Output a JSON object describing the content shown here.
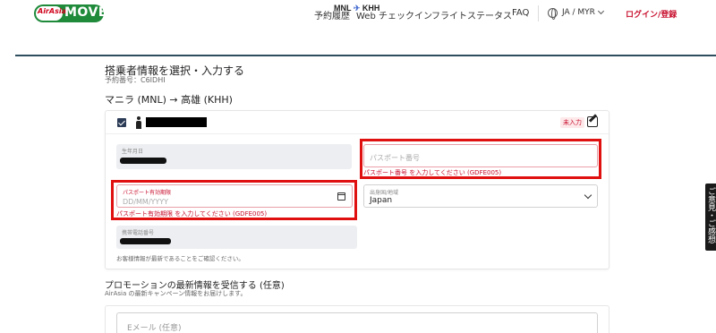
{
  "header": {
    "logo": {
      "brand_small": "AirAsia",
      "brand_main": "MOVE"
    },
    "nav": [
      "予約履歴",
      "Web チェックイン",
      "フライトステータス",
      "FAQ"
    ],
    "language": "JA / MYR",
    "login": "ログイン/登録"
  },
  "route": {
    "from": "MNL",
    "to": "KHH"
  },
  "page": {
    "title": "搭乗者情報を選択・入力する",
    "booking_ref": "予約番号：C6IDHI",
    "segment": "マニラ (MNL) → 高雄 (KHH)"
  },
  "passenger": {
    "status_badge": "未入力",
    "fields": {
      "country_label": "生年月日",
      "passport_number_placeholder": "パスポート番号",
      "passport_number_error": "パスポート番号 を入力してください (GDFE005)",
      "passport_expiry_label": "パスポート有効期限",
      "passport_expiry_placeholder": "DD/MM/YYYY",
      "passport_expiry_error": "パスポート有効期限 を入力してください (GDFE005)",
      "issuing_country_label": "出身国/地域",
      "issuing_country_value": "Japan",
      "phone_label": "携帯電話番号",
      "notice": "お客様情報が最新であることをご確認ください。"
    }
  },
  "promo": {
    "title": "プロモーションの最新情報を受信する (任意)",
    "subtitle": "AirAsia の最新キャンペーン情報をお届けします。",
    "email_placeholder": "Eメール (任意)"
  },
  "feedback_tab": "ご意見・ご感想",
  "colors": {
    "brand_green": "#1e8a3a",
    "error_red": "#c8102e",
    "highlight_red": "#e01010",
    "route_line": "#2e4e5e"
  }
}
